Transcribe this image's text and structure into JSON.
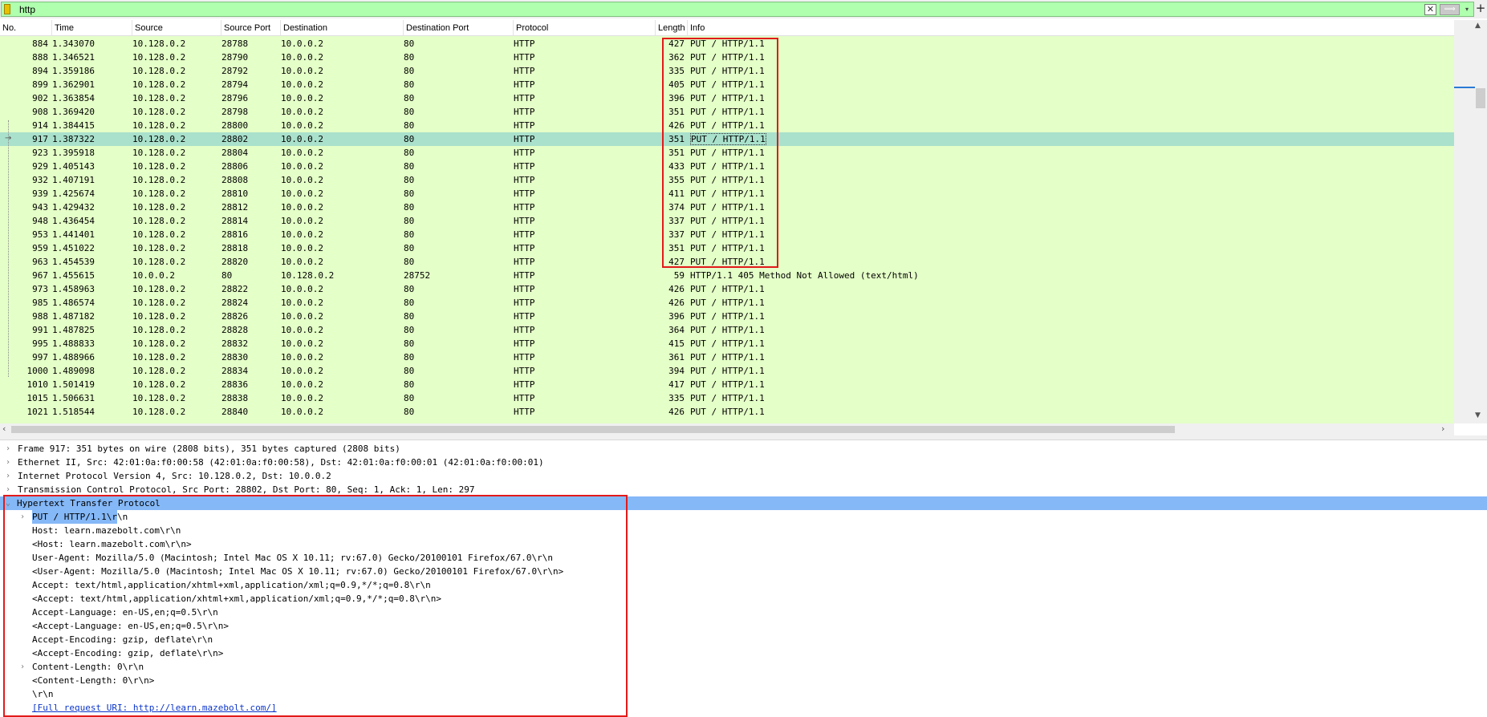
{
  "filter": {
    "value": "http",
    "clear_icon": "✕",
    "apply_icon": "⟹",
    "dropdown_icon": "▾",
    "add_icon": "+"
  },
  "columns": [
    "No.",
    "Time",
    "Source",
    "Source Port",
    "Destination",
    "Destination Port",
    "Protocol",
    "Length",
    "Info"
  ],
  "packets": [
    {
      "no": "884",
      "time": "1.343070",
      "src": "10.128.0.2",
      "sport": "28788",
      "dst": "10.0.0.2",
      "dport": "80",
      "proto": "HTTP",
      "len": "427",
      "info": "PUT / HTTP/1.1"
    },
    {
      "no": "888",
      "time": "1.346521",
      "src": "10.128.0.2",
      "sport": "28790",
      "dst": "10.0.0.2",
      "dport": "80",
      "proto": "HTTP",
      "len": "362",
      "info": "PUT / HTTP/1.1"
    },
    {
      "no": "894",
      "time": "1.359186",
      "src": "10.128.0.2",
      "sport": "28792",
      "dst": "10.0.0.2",
      "dport": "80",
      "proto": "HTTP",
      "len": "335",
      "info": "PUT / HTTP/1.1"
    },
    {
      "no": "899",
      "time": "1.362901",
      "src": "10.128.0.2",
      "sport": "28794",
      "dst": "10.0.0.2",
      "dport": "80",
      "proto": "HTTP",
      "len": "405",
      "info": "PUT / HTTP/1.1"
    },
    {
      "no": "902",
      "time": "1.363854",
      "src": "10.128.0.2",
      "sport": "28796",
      "dst": "10.0.0.2",
      "dport": "80",
      "proto": "HTTP",
      "len": "396",
      "info": "PUT / HTTP/1.1"
    },
    {
      "no": "908",
      "time": "1.369420",
      "src": "10.128.0.2",
      "sport": "28798",
      "dst": "10.0.0.2",
      "dport": "80",
      "proto": "HTTP",
      "len": "351",
      "info": "PUT / HTTP/1.1"
    },
    {
      "no": "914",
      "time": "1.384415",
      "src": "10.128.0.2",
      "sport": "28800",
      "dst": "10.0.0.2",
      "dport": "80",
      "proto": "HTTP",
      "len": "426",
      "info": "PUT / HTTP/1.1"
    },
    {
      "no": "917",
      "time": "1.387322",
      "src": "10.128.0.2",
      "sport": "28802",
      "dst": "10.0.0.2",
      "dport": "80",
      "proto": "HTTP",
      "len": "351",
      "info": "PUT / HTTP/1.1",
      "selected": true
    },
    {
      "no": "923",
      "time": "1.395918",
      "src": "10.128.0.2",
      "sport": "28804",
      "dst": "10.0.0.2",
      "dport": "80",
      "proto": "HTTP",
      "len": "351",
      "info": "PUT / HTTP/1.1"
    },
    {
      "no": "929",
      "time": "1.405143",
      "src": "10.128.0.2",
      "sport": "28806",
      "dst": "10.0.0.2",
      "dport": "80",
      "proto": "HTTP",
      "len": "433",
      "info": "PUT / HTTP/1.1"
    },
    {
      "no": "932",
      "time": "1.407191",
      "src": "10.128.0.2",
      "sport": "28808",
      "dst": "10.0.0.2",
      "dport": "80",
      "proto": "HTTP",
      "len": "355",
      "info": "PUT / HTTP/1.1"
    },
    {
      "no": "939",
      "time": "1.425674",
      "src": "10.128.0.2",
      "sport": "28810",
      "dst": "10.0.0.2",
      "dport": "80",
      "proto": "HTTP",
      "len": "411",
      "info": "PUT / HTTP/1.1"
    },
    {
      "no": "943",
      "time": "1.429432",
      "src": "10.128.0.2",
      "sport": "28812",
      "dst": "10.0.0.2",
      "dport": "80",
      "proto": "HTTP",
      "len": "374",
      "info": "PUT / HTTP/1.1"
    },
    {
      "no": "948",
      "time": "1.436454",
      "src": "10.128.0.2",
      "sport": "28814",
      "dst": "10.0.0.2",
      "dport": "80",
      "proto": "HTTP",
      "len": "337",
      "info": "PUT / HTTP/1.1"
    },
    {
      "no": "953",
      "time": "1.441401",
      "src": "10.128.0.2",
      "sport": "28816",
      "dst": "10.0.0.2",
      "dport": "80",
      "proto": "HTTP",
      "len": "337",
      "info": "PUT / HTTP/1.1"
    },
    {
      "no": "959",
      "time": "1.451022",
      "src": "10.128.0.2",
      "sport": "28818",
      "dst": "10.0.0.2",
      "dport": "80",
      "proto": "HTTP",
      "len": "351",
      "info": "PUT / HTTP/1.1"
    },
    {
      "no": "963",
      "time": "1.454539",
      "src": "10.128.0.2",
      "sport": "28820",
      "dst": "10.0.0.2",
      "dport": "80",
      "proto": "HTTP",
      "len": "427",
      "info": "PUT / HTTP/1.1"
    },
    {
      "no": "967",
      "time": "1.455615",
      "src": "10.0.0.2",
      "sport": "80",
      "dst": "10.128.0.2",
      "dport": "28752",
      "proto": "HTTP",
      "len": "59",
      "info": "HTTP/1.1 405 Method Not Allowed  (text/html)"
    },
    {
      "no": "973",
      "time": "1.458963",
      "src": "10.128.0.2",
      "sport": "28822",
      "dst": "10.0.0.2",
      "dport": "80",
      "proto": "HTTP",
      "len": "426",
      "info": "PUT / HTTP/1.1"
    },
    {
      "no": "985",
      "time": "1.486574",
      "src": "10.128.0.2",
      "sport": "28824",
      "dst": "10.0.0.2",
      "dport": "80",
      "proto": "HTTP",
      "len": "426",
      "info": "PUT / HTTP/1.1"
    },
    {
      "no": "988",
      "time": "1.487182",
      "src": "10.128.0.2",
      "sport": "28826",
      "dst": "10.0.0.2",
      "dport": "80",
      "proto": "HTTP",
      "len": "396",
      "info": "PUT / HTTP/1.1"
    },
    {
      "no": "991",
      "time": "1.487825",
      "src": "10.128.0.2",
      "sport": "28828",
      "dst": "10.0.0.2",
      "dport": "80",
      "proto": "HTTP",
      "len": "364",
      "info": "PUT / HTTP/1.1"
    },
    {
      "no": "995",
      "time": "1.488833",
      "src": "10.128.0.2",
      "sport": "28832",
      "dst": "10.0.0.2",
      "dport": "80",
      "proto": "HTTP",
      "len": "415",
      "info": "PUT / HTTP/1.1"
    },
    {
      "no": "997",
      "time": "1.488966",
      "src": "10.128.0.2",
      "sport": "28830",
      "dst": "10.0.0.2",
      "dport": "80",
      "proto": "HTTP",
      "len": "361",
      "info": "PUT / HTTP/1.1"
    },
    {
      "no": "1000",
      "time": "1.489098",
      "src": "10.128.0.2",
      "sport": "28834",
      "dst": "10.0.0.2",
      "dport": "80",
      "proto": "HTTP",
      "len": "394",
      "info": "PUT / HTTP/1.1"
    },
    {
      "no": "1010",
      "time": "1.501419",
      "src": "10.128.0.2",
      "sport": "28836",
      "dst": "10.0.0.2",
      "dport": "80",
      "proto": "HTTP",
      "len": "417",
      "info": "PUT / HTTP/1.1"
    },
    {
      "no": "1015",
      "time": "1.506631",
      "src": "10.128.0.2",
      "sport": "28838",
      "dst": "10.0.0.2",
      "dport": "80",
      "proto": "HTTP",
      "len": "335",
      "info": "PUT / HTTP/1.1"
    },
    {
      "no": "1021",
      "time": "1.518544",
      "src": "10.128.0.2",
      "sport": "28840",
      "dst": "10.0.0.2",
      "dport": "80",
      "proto": "HTTP",
      "len": "426",
      "info": "PUT / HTTP/1.1"
    }
  ],
  "details": [
    {
      "text": "Frame 917: 351 bytes on wire (2808 bits), 351 bytes captured (2808 bits)",
      "toggle": "›"
    },
    {
      "text": "Ethernet II, Src: 42:01:0a:f0:00:58 (42:01:0a:f0:00:58), Dst: 42:01:0a:f0:00:01 (42:01:0a:f0:00:01)",
      "toggle": "›"
    },
    {
      "text": "Internet Protocol Version 4, Src: 10.128.0.2, Dst: 10.0.0.2",
      "toggle": "›"
    },
    {
      "text": "Transmission Control Protocol, Src Port: 28802, Dst Port: 80, Seq: 1, Ack: 1, Len: 297",
      "toggle": "›"
    },
    {
      "text": "Hypertext Transfer Protocol",
      "toggle": "⌄",
      "highlight": true
    },
    {
      "text": "PUT / HTTP/1.1\\r\\n",
      "toggle": "›",
      "indent": 1
    },
    {
      "text": "Host: learn.mazebolt.com\\r\\n",
      "indent": 1
    },
    {
      "text": "<Host: learn.mazebolt.com\\r\\n>",
      "indent": 1
    },
    {
      "text": "User-Agent: Mozilla/5.0 (Macintosh; Intel Mac OS X 10.11; rv:67.0) Gecko/20100101 Firefox/67.0\\r\\n",
      "indent": 1
    },
    {
      "text": "<User-Agent: Mozilla/5.0 (Macintosh; Intel Mac OS X 10.11; rv:67.0) Gecko/20100101 Firefox/67.0\\r\\n>",
      "indent": 1
    },
    {
      "text": "Accept: text/html,application/xhtml+xml,application/xml;q=0.9,*/*;q=0.8\\r\\n",
      "indent": 1
    },
    {
      "text": "<Accept: text/html,application/xhtml+xml,application/xml;q=0.9,*/*;q=0.8\\r\\n>",
      "indent": 1
    },
    {
      "text": "Accept-Language: en-US,en;q=0.5\\r\\n",
      "indent": 1
    },
    {
      "text": "<Accept-Language: en-US,en;q=0.5\\r\\n>",
      "indent": 1
    },
    {
      "text": "Accept-Encoding: gzip, deflate\\r\\n",
      "indent": 1
    },
    {
      "text": "<Accept-Encoding: gzip, deflate\\r\\n>",
      "indent": 1
    },
    {
      "text": "Content-Length: 0\\r\\n",
      "toggle": "›",
      "indent": 1
    },
    {
      "text": "<Content-Length: 0\\r\\n>",
      "indent": 1
    },
    {
      "text": "\\r\\n",
      "indent": 1
    },
    {
      "text": "[Full request URI: http://learn.mazebolt.com/]",
      "indent": 1,
      "link": true
    }
  ],
  "colors": {
    "row_bg": "#e4ffc7",
    "selected_row_bg": "#a9e1cc",
    "detail_highlight": "#85b8f7",
    "annotation": "#e21a1a",
    "filter_bg": "#afffaf"
  }
}
